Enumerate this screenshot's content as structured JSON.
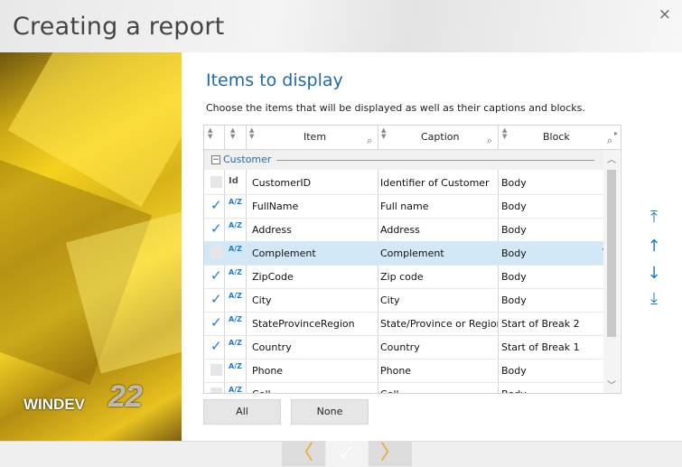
{
  "window": {
    "title": "Creating a report",
    "close_glyph": "×"
  },
  "branding": {
    "product": "WINDEV",
    "version": "22"
  },
  "page": {
    "heading": "Items to display",
    "subtitle": "Choose the items that will be displayed as well as their captions and blocks."
  },
  "table": {
    "columns": [
      "Item",
      "Caption",
      "Block"
    ],
    "group": "Customer",
    "rows": [
      {
        "checked": false,
        "icon": "id-key-icon",
        "item": "CustomerID",
        "caption": "Identifier of Customer",
        "block": "Body"
      },
      {
        "checked": true,
        "icon": "text-az-icon",
        "item": "FullName",
        "caption": "Full name",
        "block": "Body"
      },
      {
        "checked": true,
        "icon": "text-az-icon",
        "item": "Address",
        "caption": "Address",
        "block": "Body"
      },
      {
        "checked": false,
        "icon": "text-az-icon",
        "item": "Complement",
        "caption": "Complement",
        "block": "Body",
        "selected": true
      },
      {
        "checked": true,
        "icon": "text-az-icon",
        "item": "ZipCode",
        "caption": "Zip code",
        "block": "Body"
      },
      {
        "checked": true,
        "icon": "text-az-icon",
        "item": "City",
        "caption": "City",
        "block": "Body"
      },
      {
        "checked": true,
        "icon": "text-az-icon",
        "item": "StateProvinceRegion",
        "caption": "State/Province or Region",
        "block": "Start of Break 2"
      },
      {
        "checked": true,
        "icon": "text-az-icon",
        "item": "Country",
        "caption": "Country",
        "block": "Start of Break 1"
      },
      {
        "checked": false,
        "icon": "text-az-icon",
        "item": "Phone",
        "caption": "Phone",
        "block": "Body"
      },
      {
        "checked": false,
        "icon": "text-az-icon",
        "item": "Cell",
        "caption": "Cell",
        "block": "Body"
      }
    ]
  },
  "buttons": {
    "all": "All",
    "none": "None"
  },
  "icons": {
    "az": "A/Z",
    "id": "Id"
  },
  "colors": {
    "accent": "#1a7cd4",
    "heading": "#1d6aa8",
    "nav": "#f0a81c"
  }
}
